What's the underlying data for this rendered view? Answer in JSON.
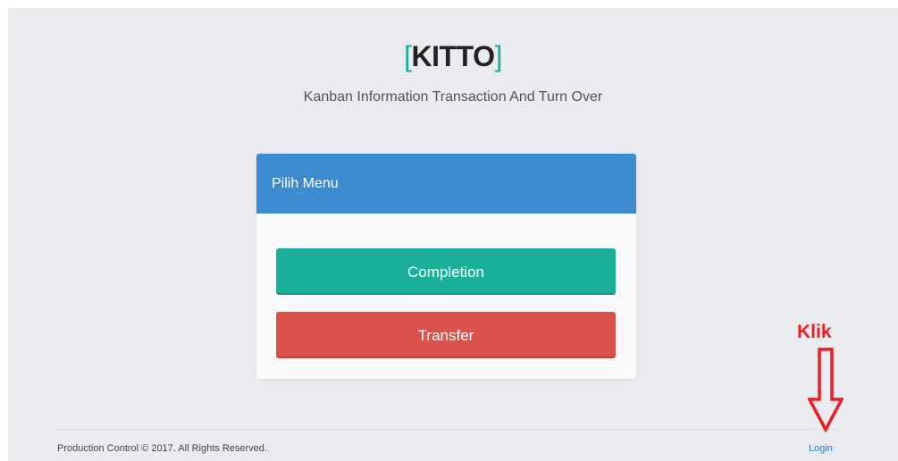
{
  "header": {
    "bracket_open": "[",
    "brand": "KITTO",
    "bracket_close": "]",
    "subtitle": "Kanban Information Transaction And Turn Over"
  },
  "menu": {
    "title": "Pilih Menu",
    "buttons": [
      {
        "label": "Completion",
        "color": "#1bb09a"
      },
      {
        "label": "Transfer",
        "color": "#db524b"
      }
    ]
  },
  "footer": {
    "copyright": "Production Control © 2017. All Rights Reserved.",
    "login_label": "Login"
  },
  "annotation": {
    "label": "Klik",
    "color": "#ee1c24",
    "icon": "down-arrow-icon"
  },
  "colors": {
    "accent": "#1aae9a",
    "panel_header": "#3e8ccf",
    "background": "#e9ebee"
  }
}
